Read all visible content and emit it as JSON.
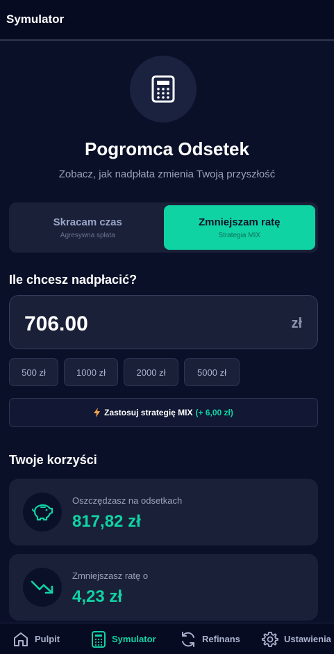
{
  "header": {
    "title": "Symulator"
  },
  "hero": {
    "icon": "calculator-icon",
    "title": "Pogromca Odsetek",
    "subtitle": "Zobacz, jak nadpłata zmienia Twoją przyszłość"
  },
  "mode_toggle": {
    "options": [
      {
        "label": "Skracam czas",
        "sub": "Agresywna spłata",
        "active": false
      },
      {
        "label": "Zmniejszam ratę",
        "sub": "Strategia MIX",
        "active": true
      }
    ]
  },
  "overpayment": {
    "question": "Ile chcesz nadpłacić?",
    "value": "706.00",
    "currency": "zł",
    "presets": [
      "500 zł",
      "1000 zł",
      "2000 zł",
      "5000 zł"
    ]
  },
  "mix_button": {
    "label": "Zastosuj strategię MIX",
    "bonus": "(+ 6,00 zł)",
    "icon": "bolt-icon"
  },
  "benefits": {
    "title": "Twoje korzyści",
    "items": [
      {
        "caption": "Oszczędzasz na odsetkach",
        "amount": "817,82 zł",
        "icon": "piggy-bank-icon"
      },
      {
        "caption": "Zmniejszasz ratę o",
        "amount": "4,23 zł",
        "icon": "trending-down-icon"
      }
    ]
  },
  "bottom_nav": {
    "items": [
      {
        "label": "Pulpit",
        "icon": "home-icon",
        "active": false
      },
      {
        "label": "Symulator",
        "icon": "calculator-icon",
        "active": true
      },
      {
        "label": "Refinans",
        "icon": "refresh-icon",
        "active": false
      },
      {
        "label": "Ustawienia",
        "icon": "gear-icon",
        "active": false
      }
    ]
  },
  "colors": {
    "background": "#0b1029",
    "card": "#1a2038",
    "accent": "#10d3a4",
    "bolt": "#f5a34a"
  }
}
